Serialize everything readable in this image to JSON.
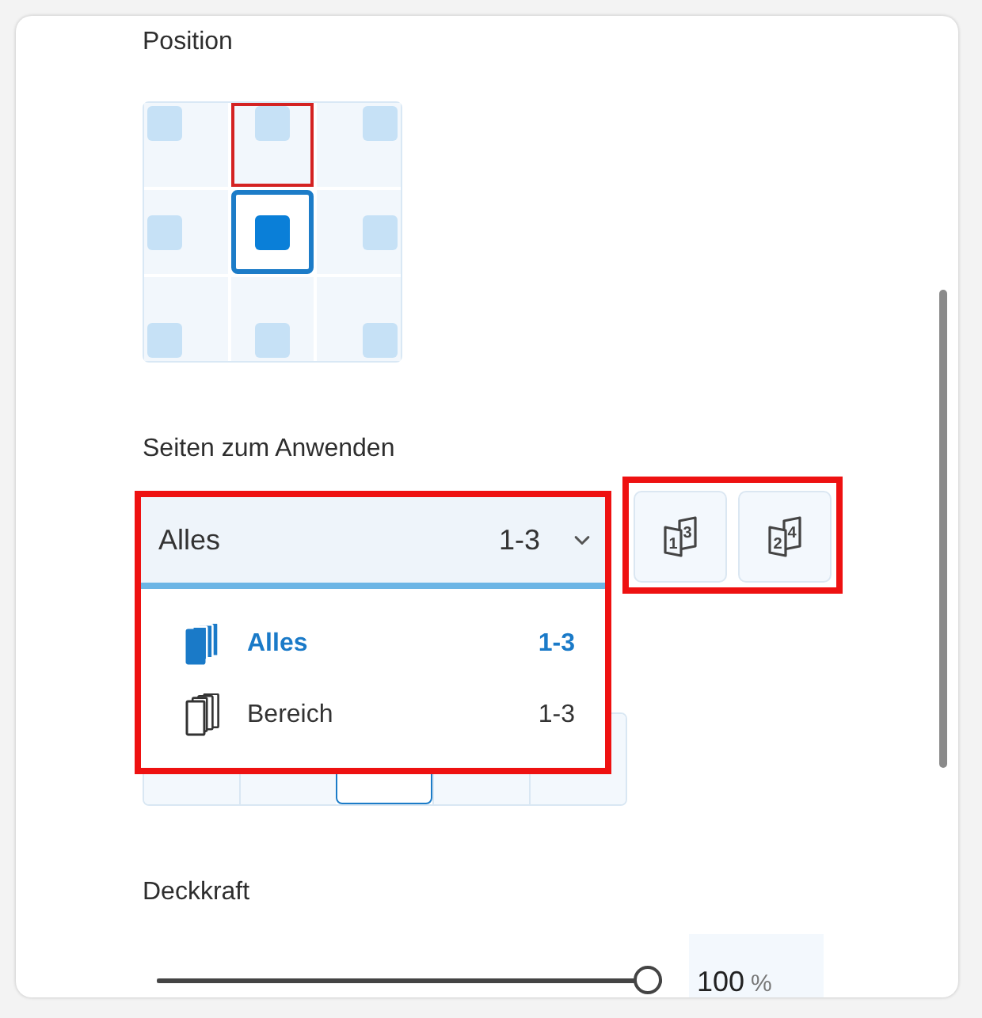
{
  "position": {
    "label": "Position",
    "cells": [
      {
        "selected": false,
        "highlighted": false
      },
      {
        "selected": false,
        "highlighted": true
      },
      {
        "selected": false,
        "highlighted": false
      },
      {
        "selected": false,
        "highlighted": false
      },
      {
        "selected": true,
        "highlighted": false
      },
      {
        "selected": false,
        "highlighted": false
      },
      {
        "selected": false,
        "highlighted": false
      },
      {
        "selected": false,
        "highlighted": false
      },
      {
        "selected": false,
        "highlighted": false
      }
    ]
  },
  "pages": {
    "label": "Seiten zum Anwenden",
    "dropdown": {
      "value": "Alles",
      "range": "1-3",
      "expanded": true,
      "highlighted": true,
      "options": [
        {
          "label": "Alles",
          "range": "1-3",
          "selected": true
        },
        {
          "label": "Bereich",
          "range": "1-3",
          "selected": false
        }
      ]
    },
    "page_buttons": {
      "highlighted": true,
      "buttons": [
        {
          "numbers": [
            "1",
            "3"
          ]
        },
        {
          "numbers": [
            "2",
            "4"
          ]
        }
      ]
    },
    "segments": [
      {
        "selected": false
      },
      {
        "selected": false
      },
      {
        "selected": true
      },
      {
        "selected": false
      },
      {
        "selected": false
      }
    ]
  },
  "opacity": {
    "label": "Deckkraft",
    "level": 1,
    "value": "100",
    "unit": "%"
  }
}
